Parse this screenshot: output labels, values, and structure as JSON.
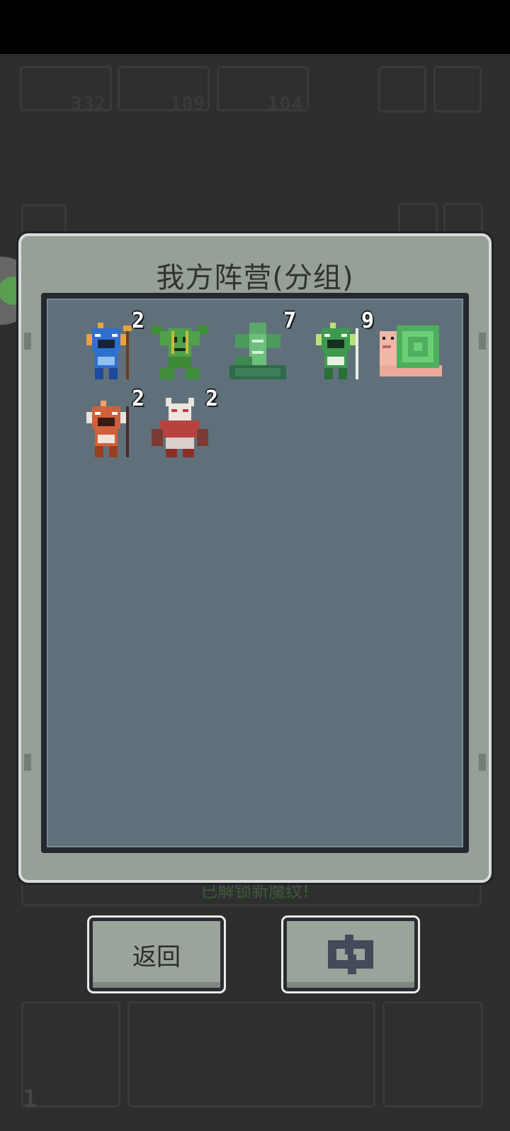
{
  "panel": {
    "title": "我方阵营(分组)"
  },
  "units": [
    {
      "name": "blue-fish-warrior",
      "count": "2"
    },
    {
      "name": "treant",
      "count": ""
    },
    {
      "name": "serpent-totem",
      "count": "7"
    },
    {
      "name": "green-fish-warrior",
      "count": "9"
    },
    {
      "name": "snail",
      "count": ""
    },
    {
      "name": "red-fish-warrior",
      "count": "2"
    },
    {
      "name": "horned-brute",
      "count": "2"
    }
  ],
  "buttons": {
    "back_label": "返回",
    "swap_icon": "swap-arrows-icon"
  },
  "background": {
    "resources": [
      "332",
      "109",
      "104"
    ],
    "hint": "已解锁新魔纹!",
    "corner_number": "1"
  },
  "colors": {
    "panel": "#96a097",
    "inner": "#5f707b",
    "frame": "#25282e"
  }
}
